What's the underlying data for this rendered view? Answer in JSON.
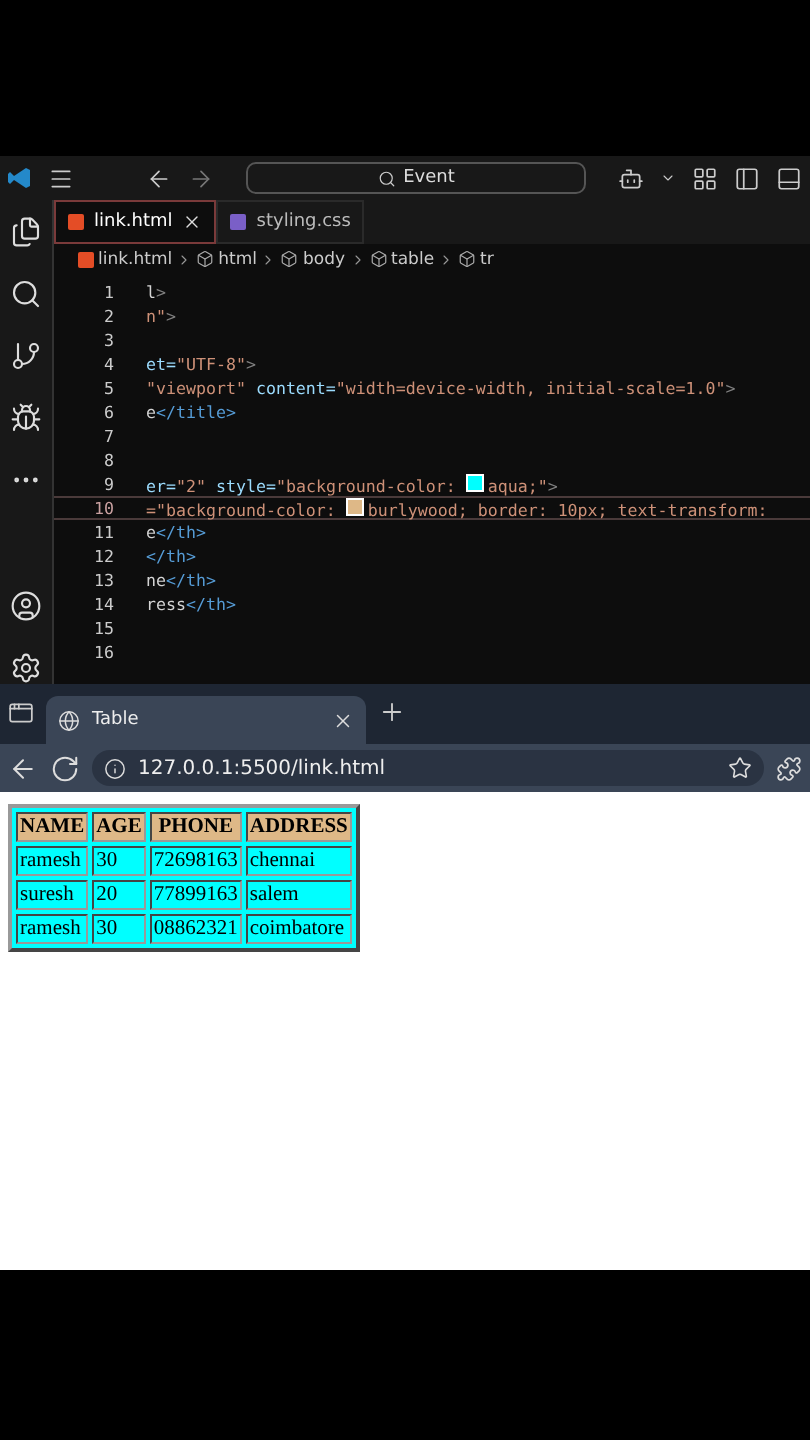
{
  "editor": {
    "search": "Event",
    "tabs": [
      {
        "label": "link.html",
        "kind": "html",
        "selected": true
      },
      {
        "label": "styling.css",
        "kind": "css",
        "selected": false
      }
    ],
    "breadcrumb": [
      {
        "label": "link.html",
        "kind": "file"
      },
      {
        "label": "html",
        "kind": "element"
      },
      {
        "label": "body",
        "kind": "element"
      },
      {
        "label": "table",
        "kind": "element"
      },
      {
        "label": "tr",
        "kind": "element"
      }
    ],
    "lines": [
      {
        "number": "1",
        "current": false,
        "tokens": [
          {
            "kind": "text",
            "text": "l"
          },
          {
            "kind": "punct",
            "text": ">"
          }
        ]
      },
      {
        "number": "2",
        "current": false,
        "tokens": [
          {
            "kind": "string",
            "text": "n\""
          },
          {
            "kind": "punct",
            "text": ">"
          }
        ]
      },
      {
        "number": "3",
        "current": false
      },
      {
        "number": "4",
        "current": false,
        "tokens": [
          {
            "kind": "attr",
            "text": "et="
          },
          {
            "kind": "string",
            "text": "\"UTF-8\""
          },
          {
            "kind": "punct",
            "text": ">"
          }
        ]
      },
      {
        "number": "5",
        "current": false,
        "tokens": [
          {
            "kind": "string",
            "text": "\"viewport\" "
          },
          {
            "kind": "attr",
            "text": "content="
          },
          {
            "kind": "string",
            "text": "\"width=device-width, initial-scale=1.0\""
          },
          {
            "kind": "punct",
            "text": ">"
          }
        ]
      },
      {
        "number": "6",
        "current": false,
        "tokens": [
          {
            "kind": "text",
            "text": "e"
          },
          {
            "kind": "tag",
            "text": "</title>"
          }
        ]
      },
      {
        "number": "7",
        "current": false
      },
      {
        "number": "8",
        "current": false
      },
      {
        "number": "9",
        "current": false,
        "tokens": [
          {
            "kind": "attr",
            "text": "er="
          },
          {
            "kind": "string",
            "text": "\"2\" "
          },
          {
            "kind": "attr",
            "text": "style="
          },
          {
            "kind": "string",
            "text": "\"background-color: "
          },
          {
            "kind": "swatch",
            "color": "#00ffff"
          },
          {
            "kind": "string",
            "text": "aqua;\""
          },
          {
            "kind": "punct",
            "text": ">"
          }
        ]
      },
      {
        "number": "10",
        "current": true,
        "tokens": [
          {
            "kind": "string",
            "text": "=\"background-color: "
          },
          {
            "kind": "swatch",
            "color": "#deb887"
          },
          {
            "kind": "string",
            "text": "burlywood; border: 10px; text-transform:"
          }
        ]
      },
      {
        "number": "11",
        "current": false,
        "tokens": [
          {
            "kind": "text",
            "text": "e"
          },
          {
            "kind": "tag",
            "text": "</th>"
          }
        ]
      },
      {
        "number": "12",
        "current": false,
        "tokens": [
          {
            "kind": "tag",
            "text": "</th>"
          }
        ]
      },
      {
        "number": "13",
        "current": false,
        "tokens": [
          {
            "kind": "text",
            "text": "ne"
          },
          {
            "kind": "tag",
            "text": "</th>"
          }
        ]
      },
      {
        "number": "14",
        "current": false,
        "tokens": [
          {
            "kind": "text",
            "text": "ress"
          },
          {
            "kind": "tag",
            "text": "</th>"
          }
        ]
      },
      {
        "number": "15",
        "current": false
      },
      {
        "number": "16",
        "current": false
      }
    ]
  },
  "browser": {
    "tab": {
      "title": "Table",
      "selected": true
    },
    "url": "127.0.0.1:5500/link.html",
    "table": {
      "columns": [
        "NAME",
        "AGE",
        "PHONE",
        "ADDRESS"
      ],
      "rows": [
        [
          "ramesh",
          "30",
          "72698163",
          "chennai"
        ],
        [
          "suresh",
          "20",
          "77899163",
          "salem"
        ],
        [
          "ramesh",
          "30",
          "08862321",
          "coimbatore"
        ]
      ]
    }
  }
}
